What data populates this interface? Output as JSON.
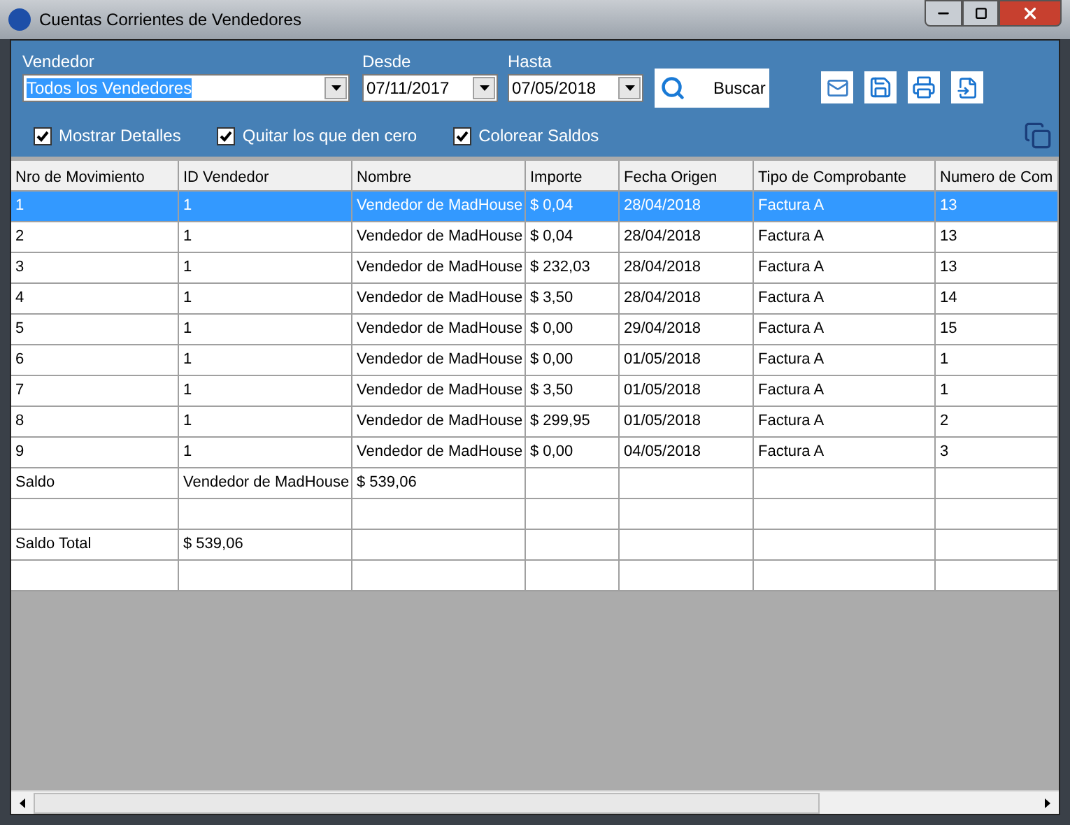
{
  "window": {
    "title": "Cuentas Corrientes de Vendedores"
  },
  "filters": {
    "vendedor": {
      "label": "Vendedor",
      "value": "Todos los Vendedores"
    },
    "desde": {
      "label": "Desde",
      "value": "07/11/2017"
    },
    "hasta": {
      "label": "Hasta",
      "value": "07/05/2018"
    },
    "search_button": "Buscar"
  },
  "options": [
    {
      "label": "Mostrar Detalles",
      "checked": true
    },
    {
      "label": "Quitar los que den cero",
      "checked": true
    },
    {
      "label": "Colorear Saldos",
      "checked": true
    }
  ],
  "table": {
    "columns": [
      "Nro de Movimiento",
      "ID Vendedor",
      "Nombre",
      "Importe",
      "Fecha Origen",
      "Tipo  de Comprobante",
      "Numero de Com"
    ],
    "rows": [
      {
        "kind": "data",
        "selected": true,
        "cells": [
          "1",
          "1",
          "Vendedor de MadHouse",
          "$ 0,04",
          "28/04/2018",
          "Factura A",
          "13"
        ]
      },
      {
        "kind": "data",
        "selected": false,
        "cells": [
          "2",
          "1",
          "Vendedor de MadHouse",
          "$ 0,04",
          "28/04/2018",
          "Factura A",
          "13"
        ]
      },
      {
        "kind": "data",
        "selected": false,
        "cells": [
          "3",
          "1",
          "Vendedor de MadHouse",
          "$ 232,03",
          "28/04/2018",
          "Factura A",
          "13"
        ]
      },
      {
        "kind": "data",
        "selected": false,
        "cells": [
          "4",
          "1",
          "Vendedor de MadHouse",
          "$ 3,50",
          "28/04/2018",
          "Factura A",
          "14"
        ]
      },
      {
        "kind": "data",
        "selected": false,
        "cells": [
          "5",
          "1",
          "Vendedor de MadHouse",
          "$ 0,00",
          "29/04/2018",
          "Factura A",
          "15"
        ]
      },
      {
        "kind": "data",
        "selected": false,
        "cells": [
          "6",
          "1",
          "Vendedor de MadHouse",
          "$ 0,00",
          "01/05/2018",
          "Factura A",
          "1"
        ]
      },
      {
        "kind": "data",
        "selected": false,
        "cells": [
          "7",
          "1",
          "Vendedor de MadHouse",
          "$ 3,50",
          "01/05/2018",
          "Factura A",
          "1"
        ]
      },
      {
        "kind": "data",
        "selected": false,
        "cells": [
          "8",
          "1",
          "Vendedor de MadHouse",
          "$ 299,95",
          "01/05/2018",
          "Factura A",
          "2"
        ]
      },
      {
        "kind": "data",
        "selected": false,
        "cells": [
          "9",
          "1",
          "Vendedor de MadHouse",
          "$ 0,00",
          "04/05/2018",
          "Factura A",
          "3"
        ]
      },
      {
        "kind": "data",
        "selected": false,
        "cells": [
          "Saldo",
          "Vendedor de MadHouse",
          "$ 539,06"
        ]
      },
      {
        "kind": "blank",
        "selected": false
      },
      {
        "kind": "data",
        "selected": false,
        "cells": [
          "Saldo Total",
          "$ 539,06"
        ]
      },
      {
        "kind": "blank",
        "selected": false
      }
    ]
  }
}
